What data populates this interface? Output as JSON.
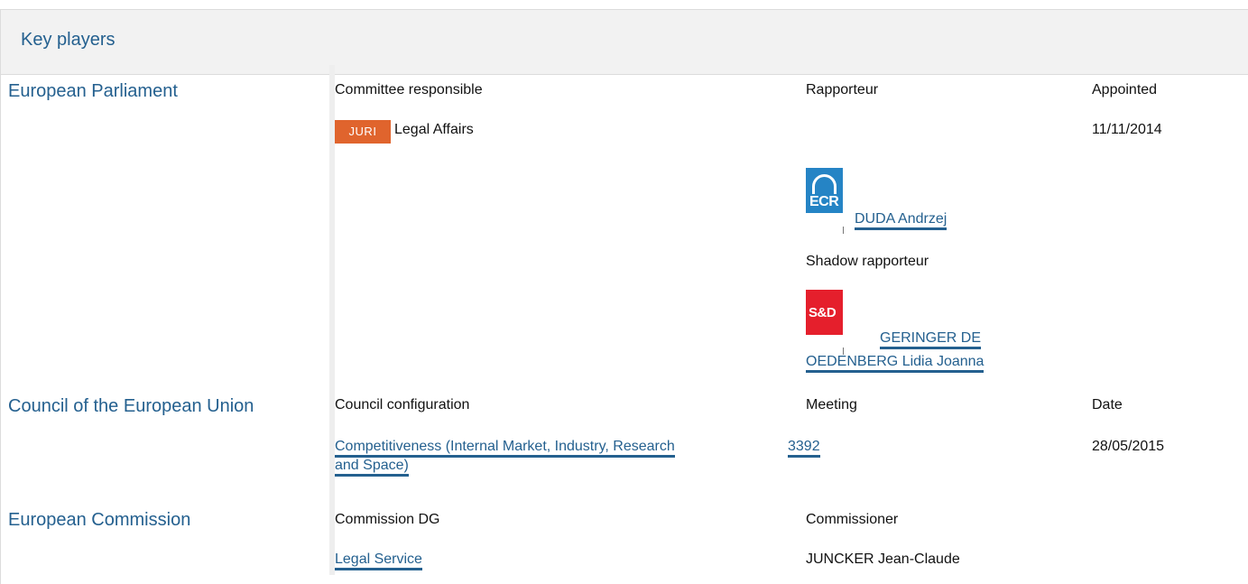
{
  "header": {
    "title": "Key players"
  },
  "parliament": {
    "name": "European Parliament",
    "col_committee": "Committee responsible",
    "col_rapporteur": "Rapporteur",
    "col_appointed": "Appointed",
    "committee_badge": "JURI",
    "committee_name": "Legal Affairs",
    "appointed_date": "11/11/2014",
    "rapporteur": {
      "group_logo": "ECR",
      "name": "DUDA Andrzej"
    },
    "shadow_label": "Shadow rapporteur",
    "shadow": {
      "group_logo": "S&D",
      "name_line1": "GERINGER DE",
      "name_line2": "OEDENBERG Lidia Joanna"
    }
  },
  "council": {
    "name": "Council of the European Union",
    "col_configuration": "Council configuration",
    "col_meeting": "Meeting",
    "col_date": "Date",
    "configuration_line1": "Competitiveness (Internal Market, Industry, Research",
    "configuration_line2": "and Space)",
    "meeting": "3392",
    "date": "28/05/2015"
  },
  "commission": {
    "name": "European Commission",
    "col_dg": "Commission DG",
    "col_commissioner": "Commissioner",
    "dg": "Legal Service",
    "commissioner": "JUNCKER Jean-Claude"
  },
  "colors": {
    "link": "#24608f",
    "juri_badge": "#e0642d",
    "ecr": "#2584c5",
    "sd": "#e51f2c"
  }
}
